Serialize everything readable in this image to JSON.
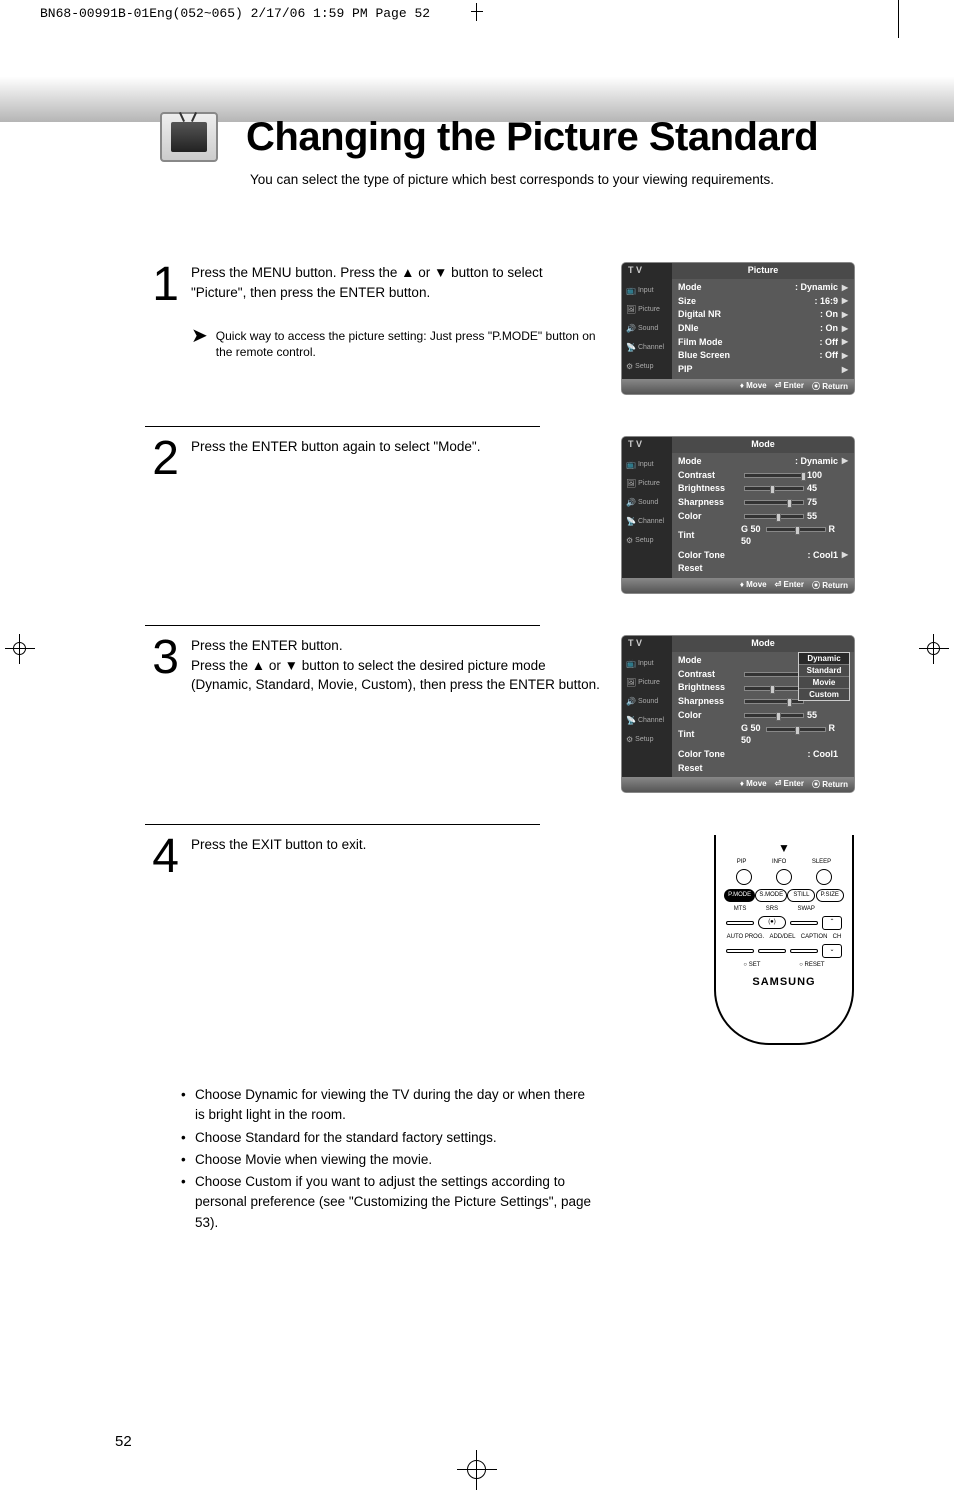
{
  "header_line": "BN68-00991B-01Eng(052~065)  2/17/06  1:59 PM  Page 52",
  "title": "Changing the Picture Standard",
  "subtitle": "You can select the type of picture which best corresponds to your viewing requirements.",
  "steps": [
    {
      "num": "1",
      "text": "Press the MENU button. Press the ▲ or ▼ button to select \"Picture\", then press the ENTER button.",
      "note": "Quick way to access the picture setting: Just press \"P.MODE\" button on the remote control."
    },
    {
      "num": "2",
      "text": "Press the ENTER button again to select \"Mode\"."
    },
    {
      "num": "3",
      "text": "Press the ENTER button.\nPress the ▲ or ▼ button to select the desired picture mode (Dynamic, Standard, Movie, Custom), then press the ENTER button."
    },
    {
      "num": "4",
      "text": "Press the EXIT button to exit."
    }
  ],
  "sidebar_items": [
    "Input",
    "Picture",
    "Sound",
    "Channel",
    "Setup"
  ],
  "menu1": {
    "tv": "T V",
    "title": "Picture",
    "lines": [
      {
        "label": "Mode",
        "value": ": Dynamic",
        "arrow": true
      },
      {
        "label": "Size",
        "value": ": 16:9",
        "arrow": true
      },
      {
        "label": "Digital NR",
        "value": ": On",
        "arrow": true
      },
      {
        "label": "DNIe",
        "value": ": On",
        "arrow": true
      },
      {
        "label": "Film Mode",
        "value": ": Off",
        "arrow": true
      },
      {
        "label": "Blue Screen",
        "value": ": Off",
        "arrow": true
      },
      {
        "label": "PIP",
        "value": "",
        "arrow": true
      }
    ],
    "footer": {
      "move": "Move",
      "enter": "Enter",
      "return": "Return"
    }
  },
  "menu2": {
    "tv": "T V",
    "title": "Mode",
    "lines": [
      {
        "label": "Mode",
        "value": ": Dynamic",
        "arrow": true
      },
      {
        "label": "Contrast",
        "slider": 100,
        "sval": "100"
      },
      {
        "label": "Brightness",
        "slider": 45,
        "sval": "45"
      },
      {
        "label": "Sharpness",
        "slider": 75,
        "sval": "75"
      },
      {
        "label": "Color",
        "slider": 55,
        "sval": "55"
      },
      {
        "label": "Tint",
        "left": "G 50",
        "slider": 50,
        "sval": "R 50"
      },
      {
        "label": "Color Tone",
        "value": ": Cool1",
        "arrow": true
      },
      {
        "label": "Reset",
        "value": "",
        "arrow": false
      }
    ],
    "footer": {
      "move": "Move",
      "enter": "Enter",
      "return": "Return"
    }
  },
  "menu3": {
    "tv": "T V",
    "title": "Mode",
    "lines": [
      {
        "label": "Mode",
        "value": ""
      },
      {
        "label": "Contrast",
        "slider": 100,
        "sval": ""
      },
      {
        "label": "Brightness",
        "slider": 45,
        "sval": ""
      },
      {
        "label": "Sharpness",
        "slider": 75,
        "sval": ""
      },
      {
        "label": "Color",
        "slider": 55,
        "sval": "55"
      },
      {
        "label": "Tint",
        "left": "G 50",
        "slider": 50,
        "sval": "R 50"
      },
      {
        "label": "Color Tone",
        "value": ": Cool1"
      },
      {
        "label": "Reset",
        "value": ""
      }
    ],
    "dropdown": [
      "Dynamic",
      "Standard",
      "Movie",
      "Custom"
    ],
    "footer": {
      "move": "Move",
      "enter": "Enter",
      "return": "Return"
    }
  },
  "bullets": [
    "Choose Dynamic for viewing the TV during the day or when there is bright light in the room.",
    "Choose Standard for the standard factory settings.",
    "Choose Movie when viewing the movie.",
    "Choose Custom if you want to adjust the settings according to personal preference (see \"Customizing the Picture Settings\", page 53)."
  ],
  "remote": {
    "row1": [
      "PIP",
      "INFO",
      "SLEEP"
    ],
    "row2": [
      "P.MODE",
      "S.MODE",
      "STILL",
      "P.SIZE"
    ],
    "row3": [
      "MTS",
      "SRS",
      "SWAP"
    ],
    "row4": [
      "AUTO PROG.",
      "ADD/DEL",
      "CAPTION",
      "CH"
    ],
    "row5": [
      "SET",
      "RESET"
    ],
    "brand": "SAMSUNG"
  },
  "page_num": "52"
}
